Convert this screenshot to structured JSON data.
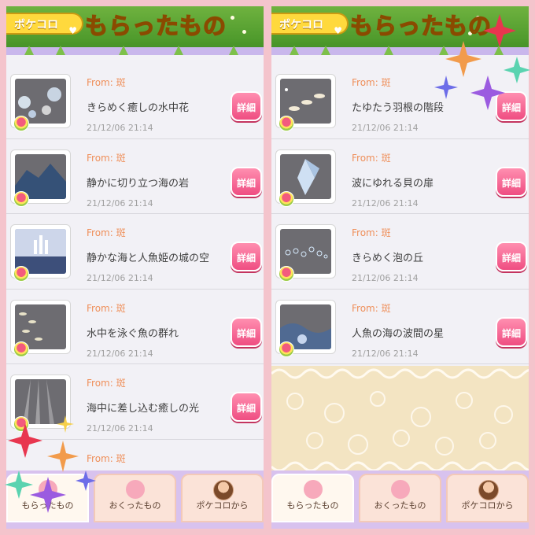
{
  "left": {
    "header": {
      "pill_label": "ポケコロ",
      "title": "もらったもの"
    },
    "items": [
      {
        "from": "From: 斑",
        "name": "きらめく癒しの水中花",
        "date": "21/12/06 21:14",
        "detail": "詳細"
      },
      {
        "from": "From: 斑",
        "name": "静かに切り立つ海の岩",
        "date": "21/12/06 21:14",
        "detail": "詳細"
      },
      {
        "from": "From: 斑",
        "name": "静かな海と人魚姫の城の空",
        "date": "21/12/06 21:14",
        "detail": "詳細"
      },
      {
        "from": "From: 斑",
        "name": "水中を泳ぐ魚の群れ",
        "date": "21/12/06 21:14",
        "detail": "詳細"
      },
      {
        "from": "From: 斑",
        "name": "海中に差し込む癒しの光",
        "date": "21/12/06 21:14",
        "detail": "詳細"
      },
      {
        "from": "From: 斑",
        "name": "",
        "date": "",
        "detail": ""
      }
    ],
    "tabs": [
      "もらったもの",
      "おくったもの",
      "ポケコロから"
    ]
  },
  "right": {
    "header": {
      "pill_label": "ポケコロ",
      "title": "もらったもの"
    },
    "items": [
      {
        "from": "From: 斑",
        "name": "たゆたう羽根の階段",
        "date": "21/12/06 21:14",
        "detail": "詳細"
      },
      {
        "from": "From: 斑",
        "name": "波にゆれる貝の扉",
        "date": "21/12/06 21:14",
        "detail": "詳細"
      },
      {
        "from": "From: 斑",
        "name": "きらめく泡の丘",
        "date": "21/12/06 21:14",
        "detail": "詳細"
      },
      {
        "from": "From: 斑",
        "name": "人魚の海の波間の星",
        "date": "21/12/06 21:14",
        "detail": "詳細"
      }
    ],
    "tabs": [
      "もらったもの",
      "おくったもの",
      "ポケコロから"
    ]
  },
  "colors": {
    "accent_pink": "#ef4d82",
    "from_orange": "#ef8f5a",
    "title_yellow": "#ffd21e",
    "tab_bg": "#d8c2ee"
  },
  "icons": [
    "heart-icon",
    "pink-heart-icon",
    "avatar-icon",
    "sparkle-icon",
    "item-badge-icon"
  ]
}
